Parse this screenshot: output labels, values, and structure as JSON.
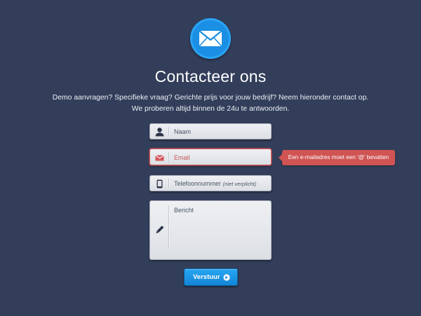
{
  "header": {
    "title": "Contacteer ons",
    "intro_line1": "Demo aanvragen? Specifieke vraag? Gerichte prijs voor jouw bedrijf? Neem hieronder contact op.",
    "intro_line2": "We proberen altijd binnen de 24u te antwoorden.",
    "logo_icon": "envelope-icon"
  },
  "form": {
    "name": {
      "placeholder": "Naam",
      "icon": "user-icon"
    },
    "email": {
      "placeholder": "Email",
      "icon": "envelope-icon",
      "state": "error",
      "error_message": "Een e-mailadres moet een '@' bevatten"
    },
    "phone": {
      "placeholder": "Telefoonnummer",
      "placeholder_note": "(niet verplicht)",
      "icon": "phone-icon"
    },
    "message": {
      "placeholder": "Bericht",
      "icon": "pencil-icon"
    },
    "submit": {
      "label": "Verstuur",
      "icon": "arrow-right-icon"
    }
  },
  "colors": {
    "background": "#323e5a",
    "accent": "#1a8fe3",
    "error": "#cf5453"
  }
}
